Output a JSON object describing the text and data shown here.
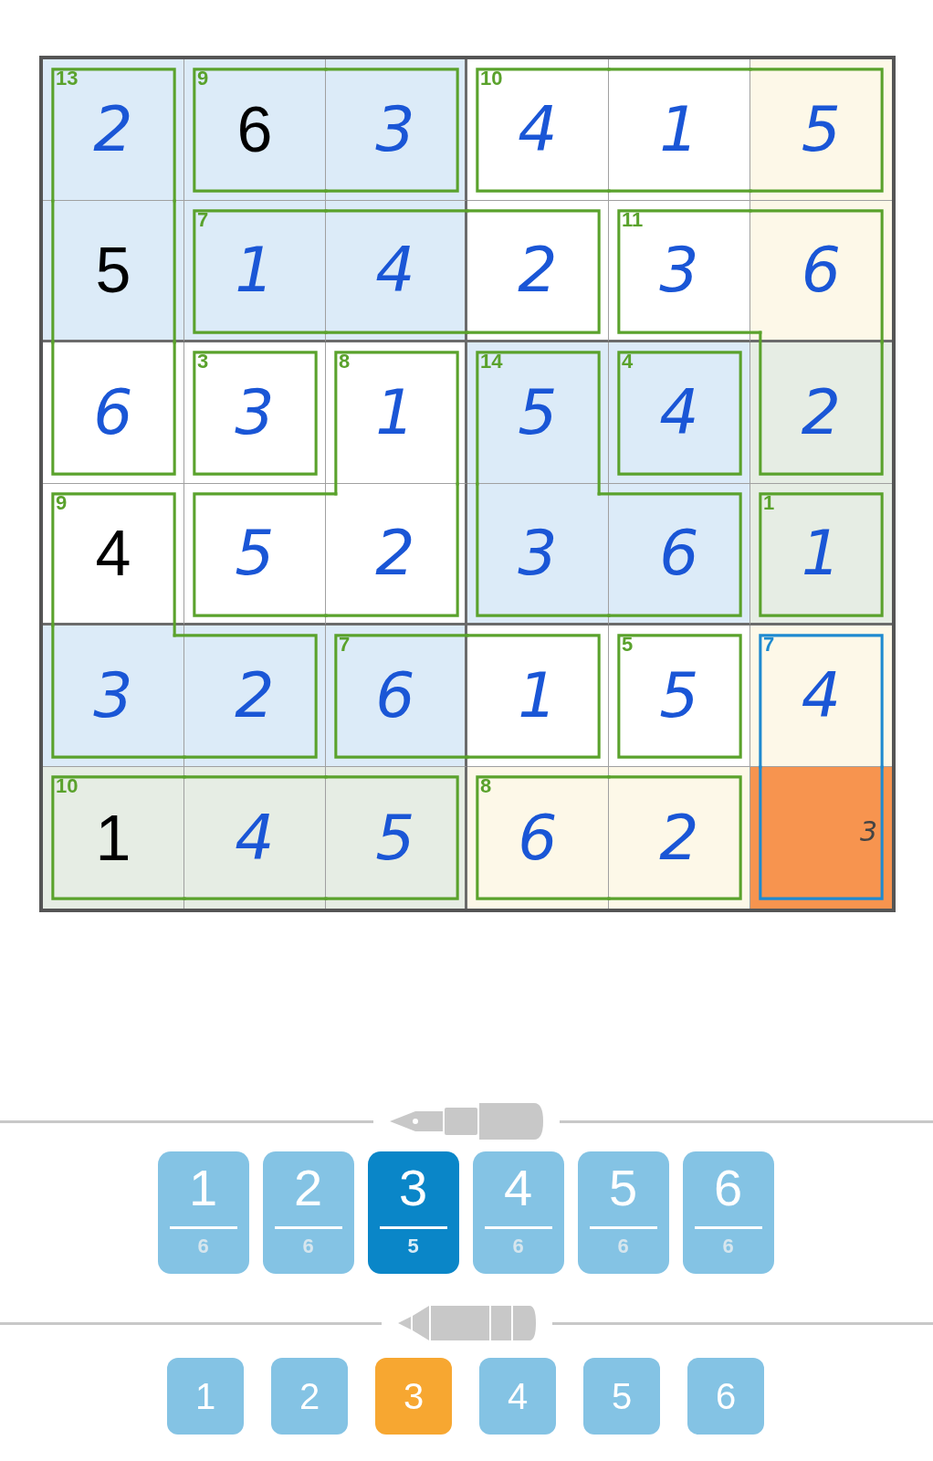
{
  "grid": {
    "rows": [
      [
        {
          "value": "2",
          "kind": "entered",
          "color": "#dcebf8",
          "cage_sum": "13",
          "cage_selected": false,
          "wall_top": true,
          "wall_right": true,
          "wall_bottom": false,
          "wall_left": true
        },
        {
          "value": "6",
          "kind": "given",
          "color": "#dcebf8",
          "cage_sum": "9",
          "cage_selected": false,
          "wall_top": true,
          "wall_right": false,
          "wall_bottom": true,
          "wall_left": true
        },
        {
          "value": "3",
          "kind": "entered",
          "color": "#dcebf8",
          "cage_selected": false,
          "wall_top": true,
          "wall_right": true,
          "wall_bottom": true,
          "wall_left": false
        },
        {
          "value": "4",
          "kind": "entered",
          "color": "#ffffff",
          "cage_sum": "10",
          "cage_selected": false,
          "wall_top": true,
          "wall_right": false,
          "wall_bottom": true,
          "wall_left": true
        },
        {
          "value": "1",
          "kind": "entered",
          "color": "#ffffff",
          "cage_selected": false,
          "wall_top": true,
          "wall_right": false,
          "wall_bottom": true,
          "wall_left": false
        },
        {
          "value": "5",
          "kind": "entered",
          "color": "#fdf8e8",
          "cage_selected": false,
          "wall_top": true,
          "wall_right": true,
          "wall_bottom": true,
          "wall_left": false
        }
      ],
      [
        {
          "value": "5",
          "kind": "given",
          "color": "#dcebf8",
          "cage_selected": false,
          "wall_top": false,
          "wall_right": true,
          "wall_bottom": false,
          "wall_left": true
        },
        {
          "value": "1",
          "kind": "entered",
          "color": "#dcebf8",
          "cage_sum": "7",
          "cage_selected": false,
          "wall_top": true,
          "wall_right": false,
          "wall_bottom": true,
          "wall_left": true
        },
        {
          "value": "4",
          "kind": "entered",
          "color": "#dcebf8",
          "cage_selected": false,
          "wall_top": true,
          "wall_right": false,
          "wall_bottom": true,
          "wall_left": false
        },
        {
          "value": "2",
          "kind": "entered",
          "color": "#ffffff",
          "cage_selected": false,
          "wall_top": true,
          "wall_right": true,
          "wall_bottom": true,
          "wall_left": false
        },
        {
          "value": "3",
          "kind": "entered",
          "color": "#ffffff",
          "cage_sum": "11",
          "cage_selected": false,
          "wall_top": true,
          "wall_right": false,
          "wall_bottom": true,
          "wall_left": true
        },
        {
          "value": "6",
          "kind": "entered",
          "color": "#fdf8e8",
          "cage_selected": false,
          "wall_top": true,
          "wall_right": true,
          "wall_bottom": false,
          "wall_left": false
        }
      ],
      [
        {
          "value": "6",
          "kind": "entered",
          "color": "#ffffff",
          "cage_selected": false,
          "wall_top": false,
          "wall_right": true,
          "wall_bottom": true,
          "wall_left": true
        },
        {
          "value": "3",
          "kind": "entered",
          "color": "#ffffff",
          "cage_sum": "3",
          "cage_selected": false,
          "wall_top": true,
          "wall_right": true,
          "wall_bottom": true,
          "wall_left": true
        },
        {
          "value": "1",
          "kind": "entered",
          "color": "#ffffff",
          "cage_sum": "8",
          "cage_selected": false,
          "wall_top": true,
          "wall_right": true,
          "wall_bottom": false,
          "wall_left": true
        },
        {
          "value": "5",
          "kind": "entered",
          "color": "#dcebf8",
          "cage_sum": "14",
          "cage_selected": false,
          "wall_top": true,
          "wall_right": true,
          "wall_bottom": false,
          "wall_left": true
        },
        {
          "value": "4",
          "kind": "entered",
          "color": "#dcebf8",
          "cage_sum": "4",
          "cage_selected": false,
          "wall_top": true,
          "wall_right": true,
          "wall_bottom": true,
          "wall_left": true
        },
        {
          "value": "2",
          "kind": "entered",
          "color": "#e6ede4",
          "cage_selected": false,
          "wall_top": false,
          "wall_right": true,
          "wall_bottom": true,
          "wall_left": true
        }
      ],
      [
        {
          "value": "4",
          "kind": "given",
          "color": "#ffffff",
          "cage_sum": "9",
          "cage_selected": false,
          "wall_top": true,
          "wall_right": true,
          "wall_bottom": false,
          "wall_left": true
        },
        {
          "value": "5",
          "kind": "entered",
          "color": "#ffffff",
          "cage_selected": false,
          "wall_top": true,
          "wall_right": false,
          "wall_bottom": true,
          "wall_left": true
        },
        {
          "value": "2",
          "kind": "entered",
          "color": "#ffffff",
          "cage_selected": false,
          "wall_top": false,
          "wall_right": true,
          "wall_bottom": true,
          "wall_left": false
        },
        {
          "value": "3",
          "kind": "entered",
          "color": "#dcebf8",
          "cage_selected": false,
          "wall_top": false,
          "wall_right": false,
          "wall_bottom": true,
          "wall_left": true
        },
        {
          "value": "6",
          "kind": "entered",
          "color": "#dcebf8",
          "cage_selected": false,
          "wall_top": true,
          "wall_right": true,
          "wall_bottom": true,
          "wall_left": false
        },
        {
          "value": "1",
          "kind": "entered",
          "color": "#e6ede4",
          "cage_sum": "1",
          "cage_selected": false,
          "wall_top": true,
          "wall_right": true,
          "wall_bottom": true,
          "wall_left": true
        }
      ],
      [
        {
          "value": "3",
          "kind": "entered",
          "color": "#dcebf8",
          "cage_selected": false,
          "wall_top": false,
          "wall_right": false,
          "wall_bottom": true,
          "wall_left": true
        },
        {
          "value": "2",
          "kind": "entered",
          "color": "#dcebf8",
          "cage_selected": false,
          "wall_top": true,
          "wall_right": true,
          "wall_bottom": true,
          "wall_left": false
        },
        {
          "value": "6",
          "kind": "entered",
          "color": "#dcebf8",
          "cage_sum": "7",
          "cage_selected": false,
          "wall_top": true,
          "wall_right": false,
          "wall_bottom": true,
          "wall_left": true
        },
        {
          "value": "1",
          "kind": "entered",
          "color": "#ffffff",
          "cage_selected": false,
          "wall_top": true,
          "wall_right": true,
          "wall_bottom": true,
          "wall_left": false
        },
        {
          "value": "5",
          "kind": "entered",
          "color": "#ffffff",
          "cage_sum": "5",
          "cage_selected": false,
          "wall_top": true,
          "wall_right": true,
          "wall_bottom": true,
          "wall_left": true
        },
        {
          "value": "4",
          "kind": "entered",
          "color": "#fdf8e8",
          "cage_sum": "7",
          "cage_selected": true,
          "wall_top": true,
          "wall_right": true,
          "wall_bottom": false,
          "wall_left": true
        }
      ],
      [
        {
          "value": "1",
          "kind": "given",
          "color": "#e6ede4",
          "cage_sum": "10",
          "cage_selected": false,
          "wall_top": true,
          "wall_right": false,
          "wall_bottom": true,
          "wall_left": true
        },
        {
          "value": "4",
          "kind": "entered",
          "color": "#e6ede4",
          "cage_selected": false,
          "wall_top": true,
          "wall_right": false,
          "wall_bottom": true,
          "wall_left": false
        },
        {
          "value": "5",
          "kind": "entered",
          "color": "#e6ede4",
          "cage_selected": false,
          "wall_top": true,
          "wall_right": true,
          "wall_bottom": true,
          "wall_left": false
        },
        {
          "value": "6",
          "kind": "entered",
          "color": "#fdf8e8",
          "cage_sum": "8",
          "cage_selected": false,
          "wall_top": true,
          "wall_right": false,
          "wall_bottom": true,
          "wall_left": true
        },
        {
          "value": "2",
          "kind": "entered",
          "color": "#fdf8e8",
          "cage_selected": false,
          "wall_top": true,
          "wall_right": true,
          "wall_bottom": true,
          "wall_left": false
        },
        {
          "value": "3",
          "kind": "pencil",
          "color": "#f7944f",
          "cage_selected": true,
          "wall_top": false,
          "wall_right": true,
          "wall_bottom": true,
          "wall_left": true
        }
      ]
    ]
  },
  "pen_digits": [
    {
      "digit": "1",
      "count": "6",
      "selected": false
    },
    {
      "digit": "2",
      "count": "6",
      "selected": false
    },
    {
      "digit": "3",
      "count": "5",
      "selected": true
    },
    {
      "digit": "4",
      "count": "6",
      "selected": false
    },
    {
      "digit": "5",
      "count": "6",
      "selected": false
    },
    {
      "digit": "6",
      "count": "6",
      "selected": false
    }
  ],
  "pencil_digits": [
    {
      "digit": "1",
      "selected": false
    },
    {
      "digit": "2",
      "selected": false
    },
    {
      "digit": "3",
      "selected": true
    },
    {
      "digit": "4",
      "selected": false
    },
    {
      "digit": "5",
      "selected": false
    },
    {
      "digit": "6",
      "selected": false
    }
  ]
}
